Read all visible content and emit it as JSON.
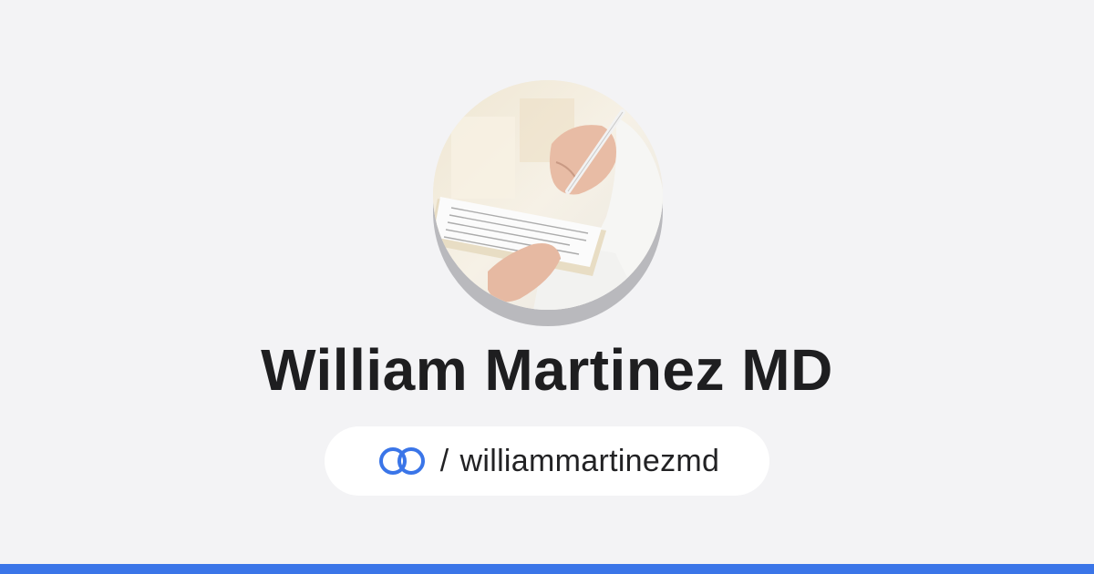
{
  "profile": {
    "name": "William Martinez MD",
    "avatar_icon": "profile-photo-doctor-writing",
    "handle_separator": "/",
    "handle": "williammartinezmd",
    "link_icon": "link-rings-icon"
  },
  "colors": {
    "background": "#f3f3f5",
    "accent": "#3a75e8",
    "text": "#1e1e20",
    "pill": "#ffffff"
  }
}
